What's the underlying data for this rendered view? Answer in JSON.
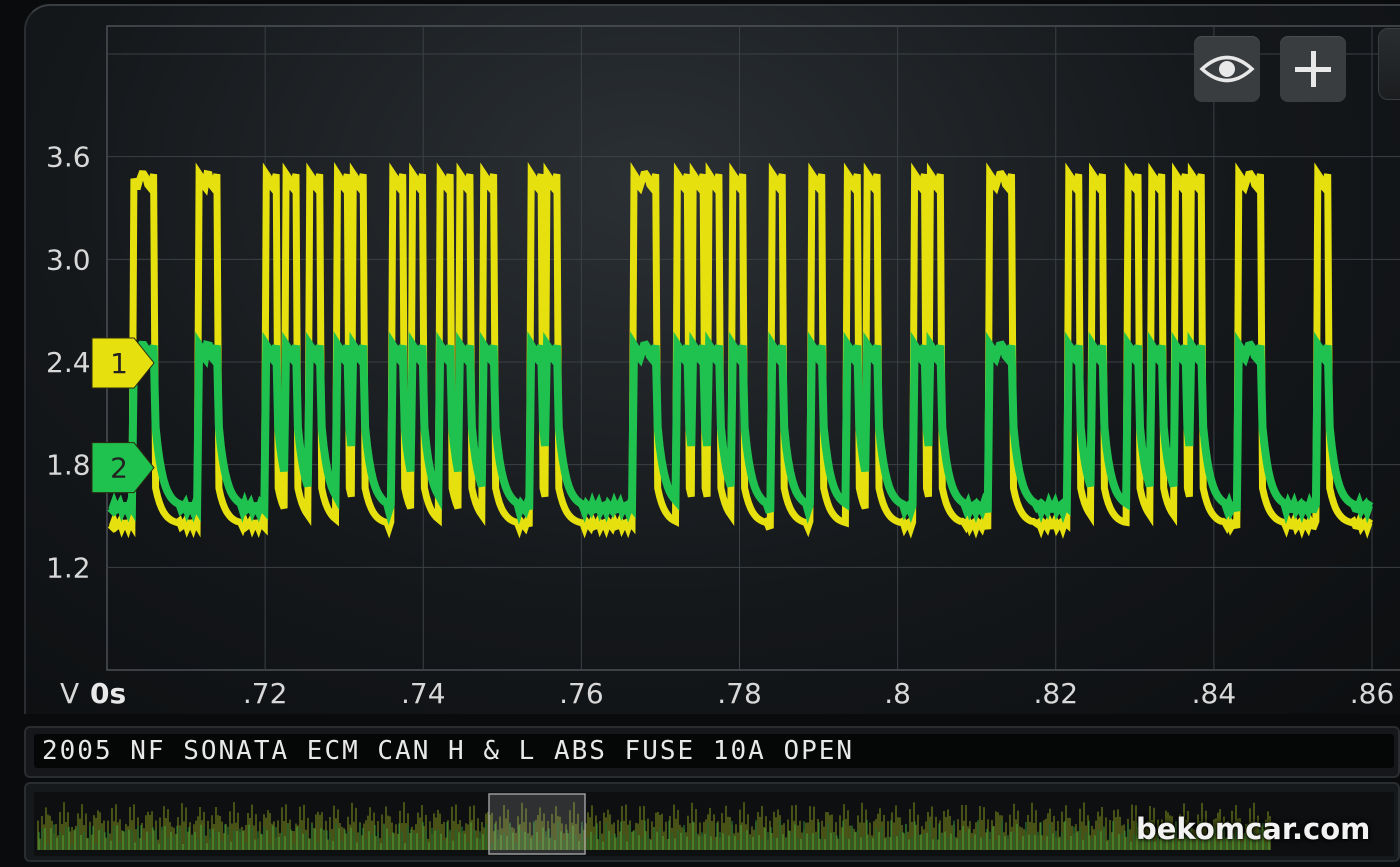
{
  "toolbar": {
    "eye_icon": "eye-icon",
    "plus_icon": "plus-icon"
  },
  "capture": {
    "title": "2005 NF SONATA ECM CAN H & L ABS FUSE 10A OPEN"
  },
  "watermark": "bekomcar.com",
  "channels": [
    {
      "label": "1",
      "color": "#e6e00f"
    },
    {
      "label": "2",
      "color": "#1fc24e"
    }
  ],
  "chart_data": {
    "type": "line",
    "ylabel": "V",
    "xlabel": "",
    "x_start_label": "0s",
    "y_ticks": [
      "3.6",
      "3.0",
      "2.4",
      "1.8",
      "1.2"
    ],
    "x_ticks": [
      ".72",
      ".74",
      ".76",
      ".78",
      ".8",
      ".82",
      ".84",
      ".86"
    ],
    "ylim": [
      0.6,
      4.2
    ],
    "xlim": [
      0.7,
      0.86
    ],
    "grid": true,
    "series": [
      {
        "name": "1",
        "color": "#e6e00f",
        "baseline": 1.45,
        "peak": 3.5
      },
      {
        "name": "2",
        "color": "#1fc24e",
        "baseline": 1.55,
        "peak": 2.5
      }
    ],
    "pulse_times": [
      0.7032,
      0.7045,
      0.7115,
      0.7125,
      0.72,
      0.7225,
      0.7255,
      0.729,
      0.731,
      0.736,
      0.7385,
      0.742,
      0.7445,
      0.7475,
      0.7535,
      0.7555,
      0.7665,
      0.768,
      0.772,
      0.774,
      0.776,
      0.779,
      0.784,
      0.789,
      0.7935,
      0.796,
      0.802,
      0.804,
      0.8115,
      0.813,
      0.8215,
      0.8245,
      0.829,
      0.832,
      0.835,
      0.837,
      0.843,
      0.8445,
      0.853
    ]
  }
}
